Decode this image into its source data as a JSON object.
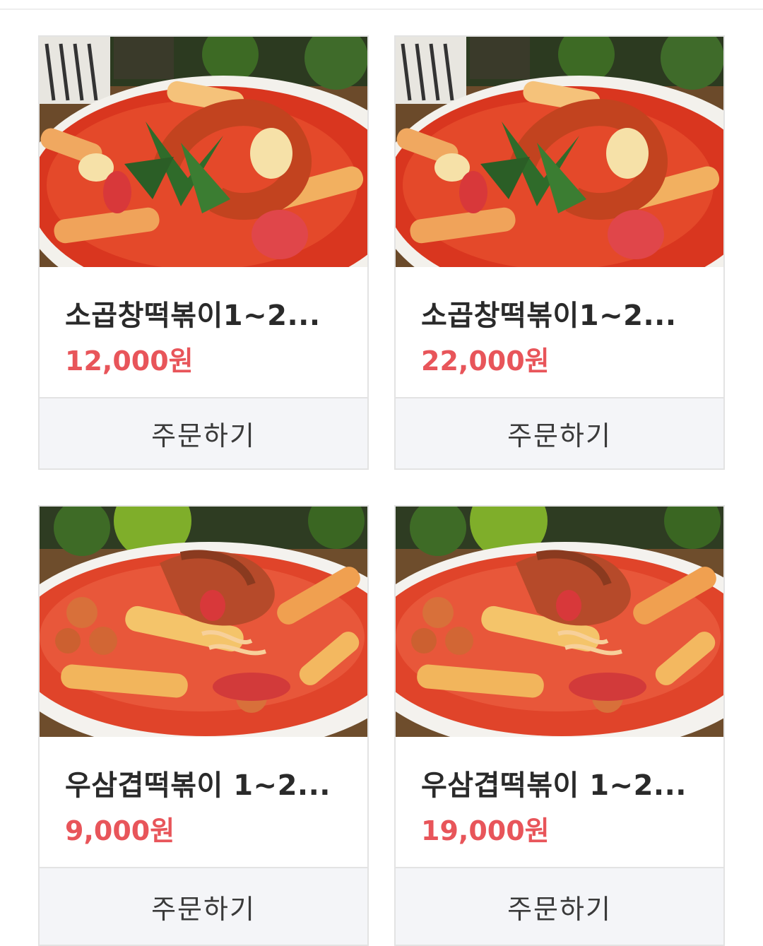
{
  "products": [
    {
      "name": "소곱창떡볶이1~2...",
      "price": "12,000원",
      "order_label": "주문하기",
      "image": "gopchang-tteokbokki-photo"
    },
    {
      "name": "소곱창떡볶이1~2...",
      "price": "22,000원",
      "order_label": "주문하기",
      "image": "gopchang-tteokbokki-photo"
    },
    {
      "name": "우삼겹떡볶이 1~2...",
      "price": "9,000원",
      "order_label": "주문하기",
      "image": "usamgyeop-tteokbokki-photo"
    },
    {
      "name": "우삼겹떡볶이 1~2...",
      "price": "19,000원",
      "order_label": "주문하기",
      "image": "usamgyeop-tteokbokki-photo"
    }
  ],
  "colors": {
    "price": "#e8555a",
    "title": "#2a2a2a",
    "button_bg": "#f4f5f8",
    "border": "#e3e3e3"
  }
}
